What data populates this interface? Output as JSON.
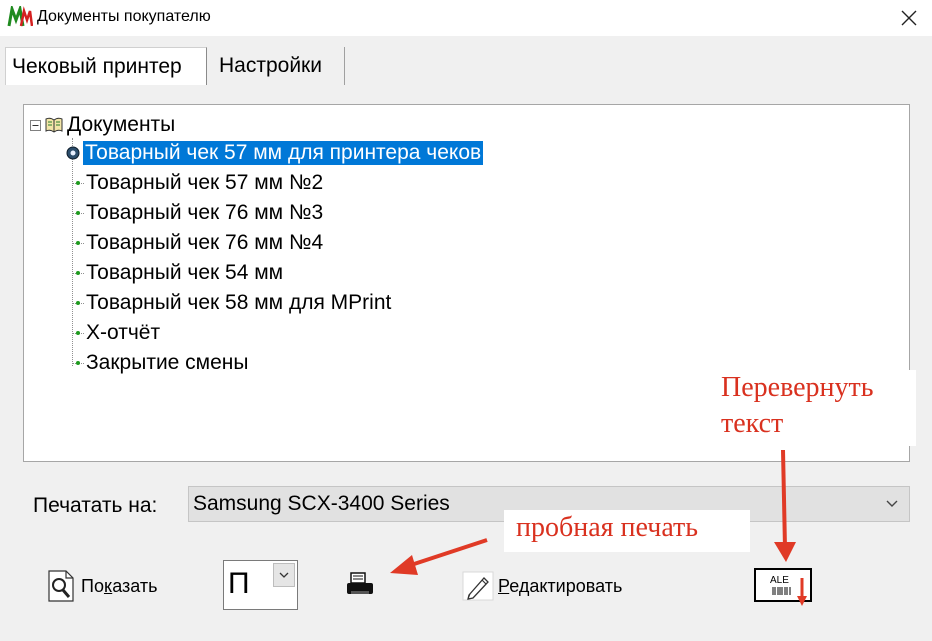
{
  "window": {
    "title": "Документы покупателю",
    "icon": "app-logo-icon",
    "close_icon": "close-icon"
  },
  "tabs": [
    {
      "label": "Чековый принтер",
      "active": true
    },
    {
      "label": "Настройки",
      "active": false
    }
  ],
  "tree": {
    "root_label": "Документы",
    "items": [
      {
        "label": "Товарный чек 57 мм для принтера чеков",
        "selected": true
      },
      {
        "label": "Товарный чек 57 мм  №2",
        "selected": false
      },
      {
        "label": "Товарный чек 76 мм №3",
        "selected": false
      },
      {
        "label": "Товарный чек 76 мм №4",
        "selected": false
      },
      {
        "label": "Товарный чек 54 мм",
        "selected": false
      },
      {
        "label": "Товарный чек 58 мм для MPrint",
        "selected": false
      },
      {
        "label": "Х-отчёт",
        "selected": false
      },
      {
        "label": "Закрытие смены",
        "selected": false
      }
    ]
  },
  "print": {
    "label": "Печатать на:",
    "printer_value": "Samsung SCX-3400 Series"
  },
  "toolbar": {
    "show_label_before": "По",
    "show_label_accel": "к",
    "show_label_after": "азать",
    "mode_value": "П",
    "edit_label_before": "Р",
    "edit_label_after": "едактировать",
    "flip_icon_text": "ALE"
  },
  "annotations": {
    "flip_line1": "Перевернуть",
    "flip_line2": "текст",
    "test_print": "пробная печать"
  },
  "colors": {
    "selection": "#0078d7",
    "annotation": "#d9311f",
    "tree_dot": "#1e9a1e"
  }
}
